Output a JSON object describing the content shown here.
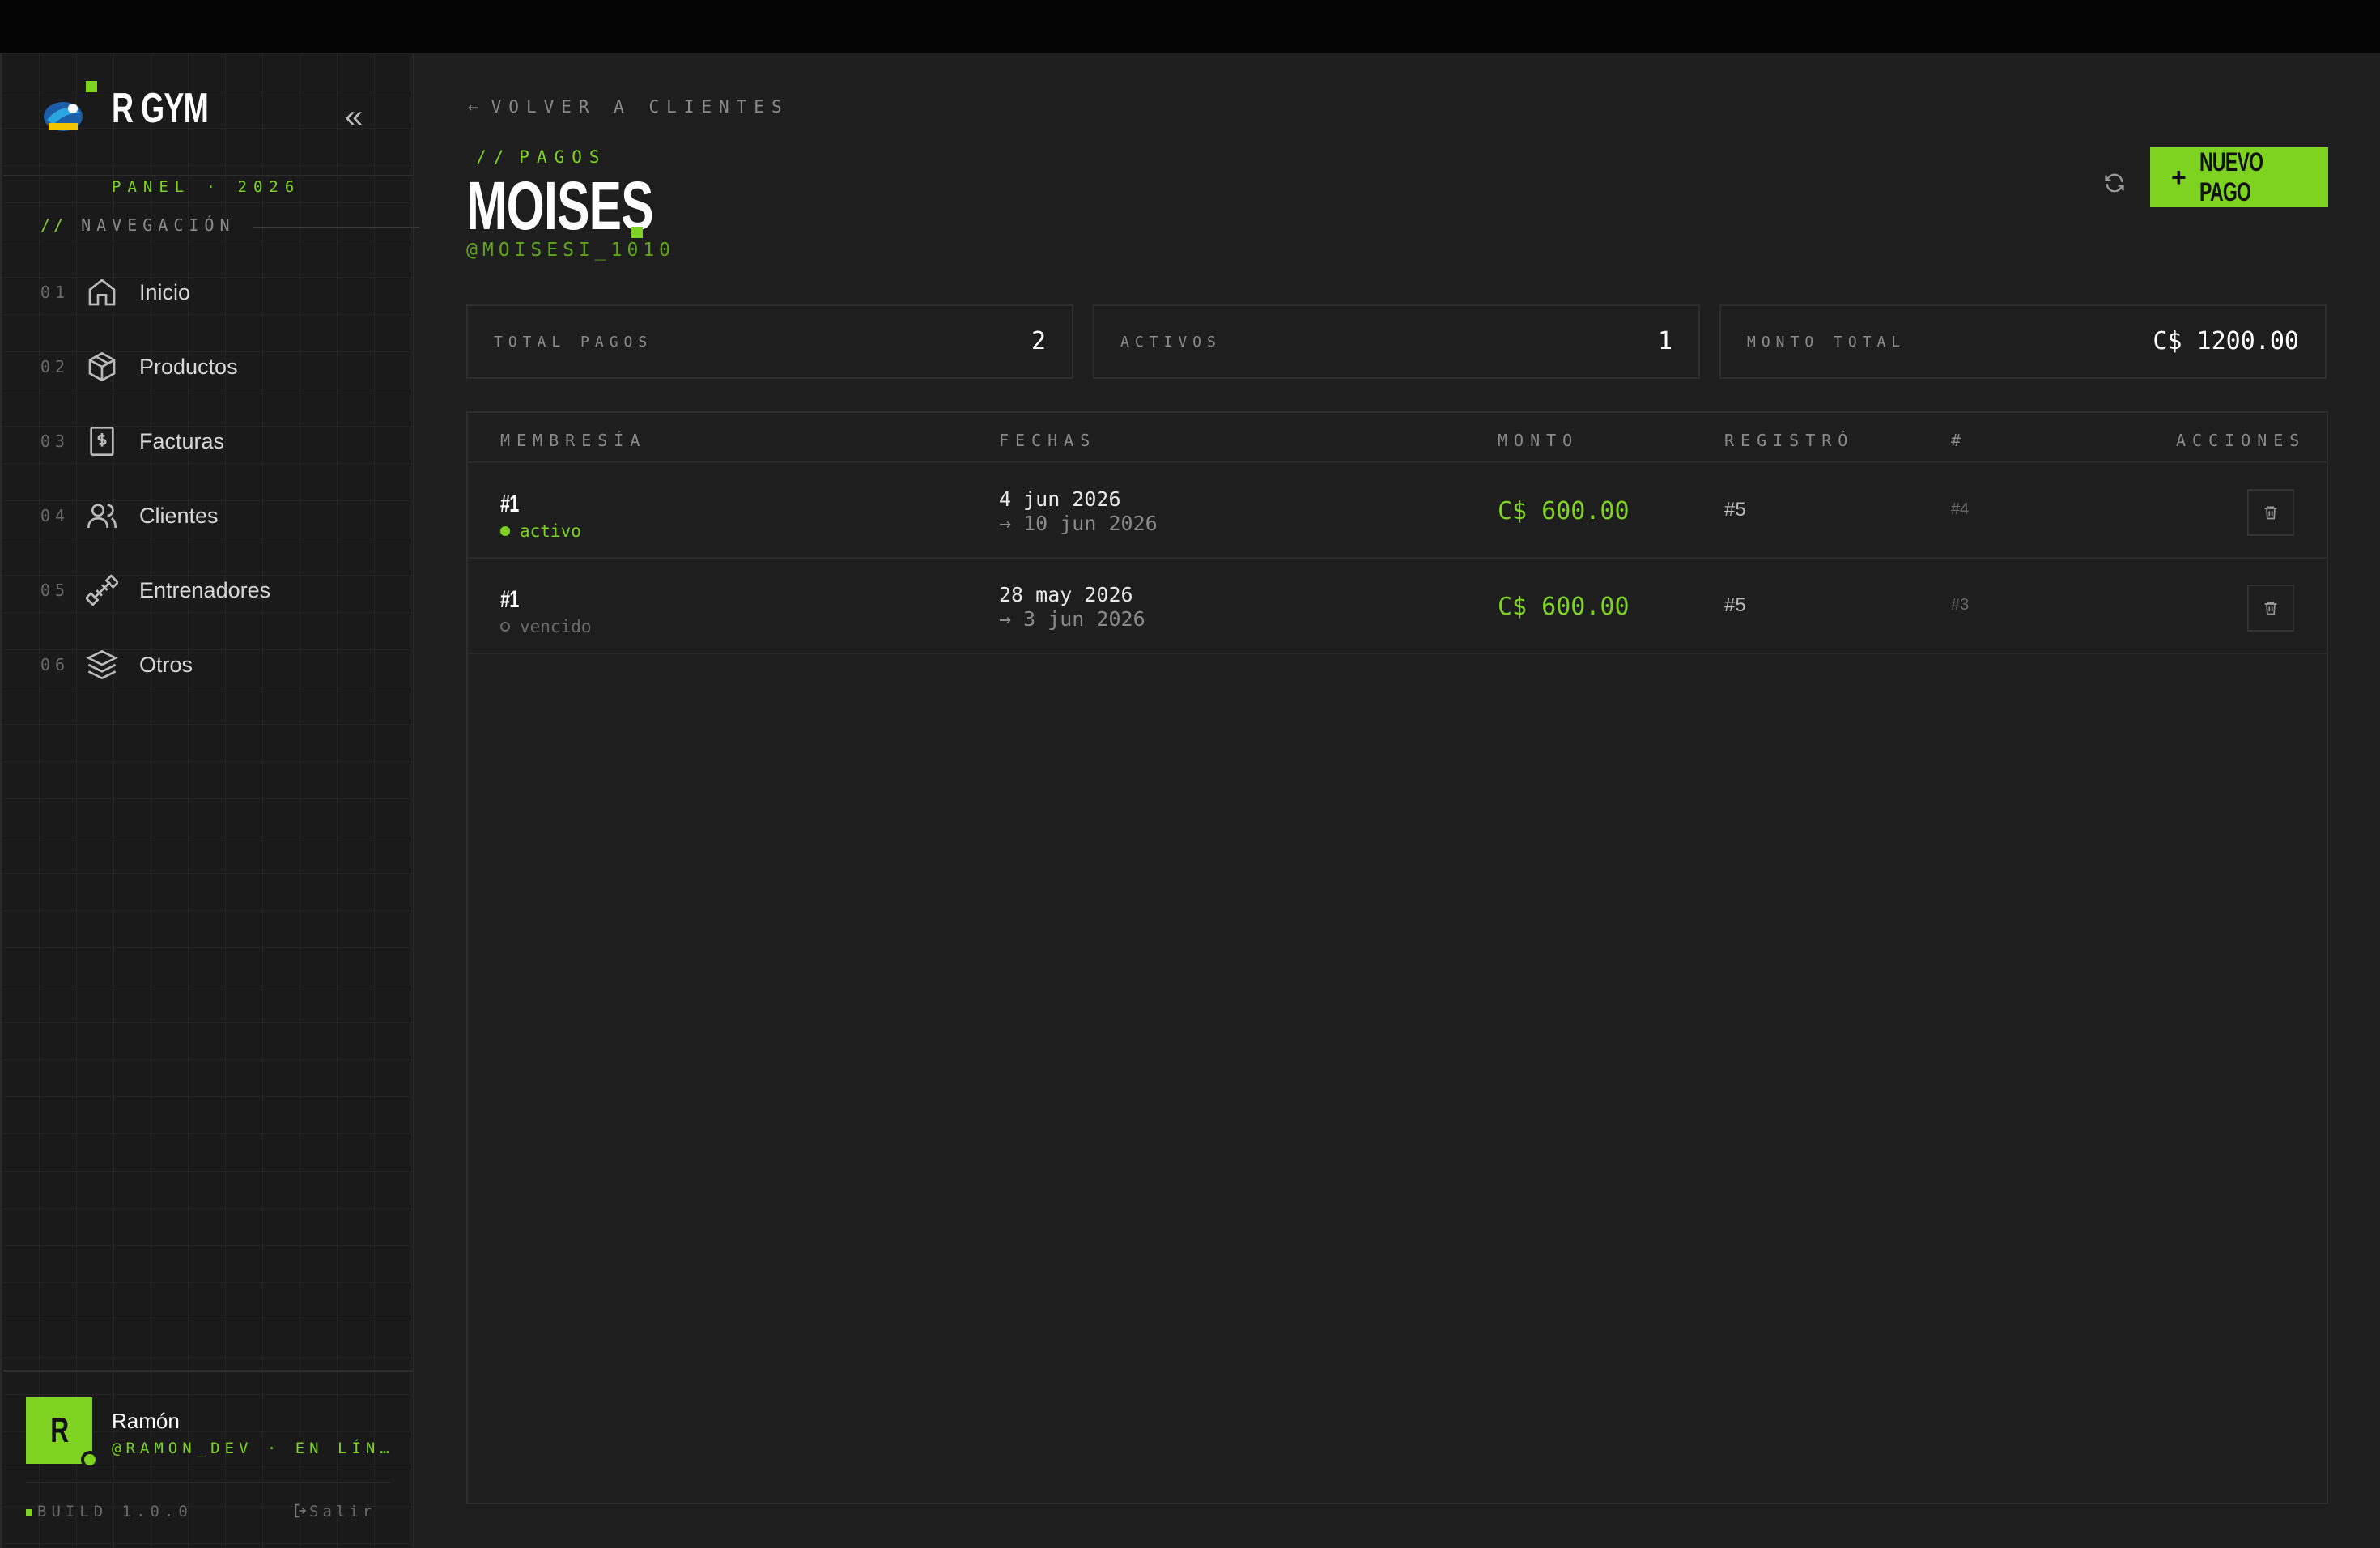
{
  "colors": {
    "accent": "#7ed321",
    "bg": "#1e1e1e",
    "sidebar_bg": "#1a1a1a"
  },
  "brand": {
    "title": "R GYM",
    "subtitle": "PANEL · 2026",
    "logo_icon": "gym-logo-icon"
  },
  "sidebar": {
    "nav_heading_prefix": "//",
    "nav_heading": "NAVEGACIÓN",
    "items": [
      {
        "num": "01",
        "label": "Inicio",
        "icon": "home-icon"
      },
      {
        "num": "02",
        "label": "Productos",
        "icon": "box-icon"
      },
      {
        "num": "03",
        "label": "Facturas",
        "icon": "invoice-icon"
      },
      {
        "num": "04",
        "label": "Clientes",
        "icon": "users-icon"
      },
      {
        "num": "05",
        "label": "Entrenadores",
        "icon": "dumbbell-icon"
      },
      {
        "num": "06",
        "label": "Otros",
        "icon": "layers-icon"
      }
    ],
    "user": {
      "initial": "R",
      "name": "Ramón",
      "handle": "@RAMON_DEV · EN LÍN…"
    },
    "build": "BUILD 1.0.0",
    "logout": "Salir"
  },
  "main": {
    "back_link": "VOLVER A CLIENTES",
    "section_prefix": "//",
    "section": "PAGOS",
    "title": "MOISES",
    "handle": "@MOISESI_1010",
    "new_button": "NUEVO PAGO",
    "stats": [
      {
        "label": "TOTAL PAGOS",
        "value": "2"
      },
      {
        "label": "ACTIVOS",
        "value": "1"
      },
      {
        "label": "MONTO TOTAL",
        "value": "C$ 1200.00"
      }
    ],
    "table": {
      "headers": [
        "MEMBRESÍA",
        "FECHAS",
        "MONTO",
        "REGISTRÓ",
        "#",
        "ACCIONES"
      ],
      "rows": [
        {
          "membresia": "#1",
          "status": "activo",
          "status_color": "#7ed321",
          "start": "4 jun 2026",
          "end": "→ 10 jun 2026",
          "monto": "C$ 600.00",
          "registro": "#5",
          "id": "#4"
        },
        {
          "membresia": "#1",
          "status": "vencido",
          "status_color": "#6a6a6a",
          "start": "28 may 2026",
          "end": "→ 3 jun 2026",
          "monto": "C$ 600.00",
          "registro": "#5",
          "id": "#3"
        }
      ]
    }
  }
}
